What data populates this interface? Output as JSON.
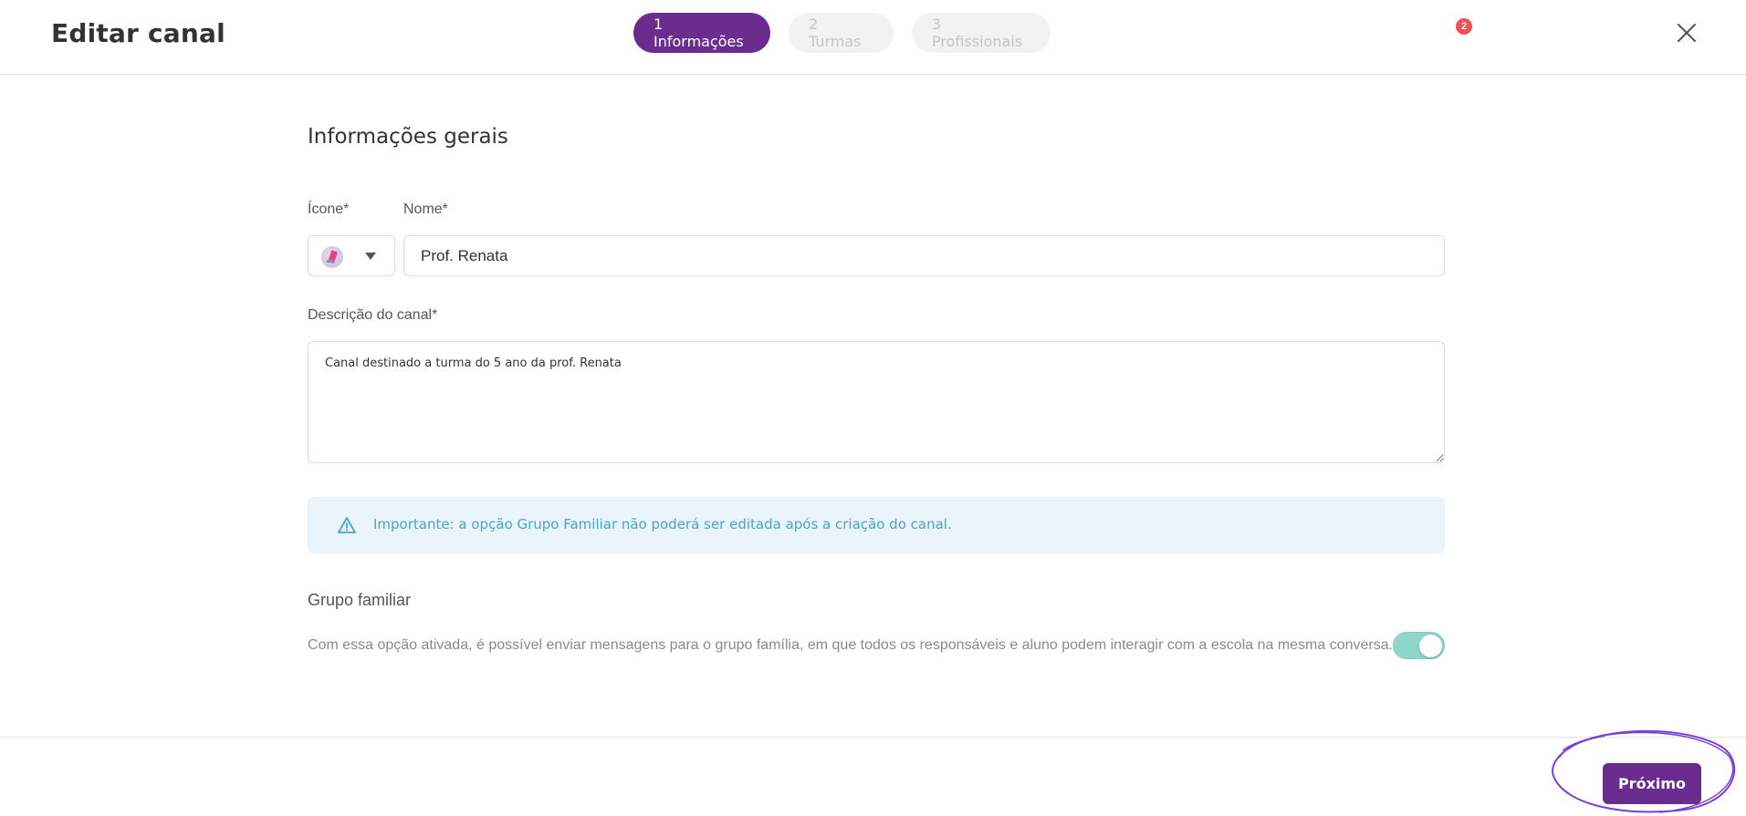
{
  "header": {
    "title": "Editar canal",
    "steps": [
      {
        "label": "1 Informações",
        "active": true
      },
      {
        "label": "2 Turmas",
        "active": false
      },
      {
        "label": "3 Profissionais",
        "active": false
      }
    ],
    "notification_count": "2",
    "close_icon": "close-icon"
  },
  "form": {
    "section_title": "Informações gerais",
    "icon_label": "Ícone*",
    "name_label": "Nome*",
    "name_value": "Prof. Renata",
    "description_label": "Descrição do canal*",
    "description_value": "Canal destinado a turma do 5 ano da prof. Renata",
    "alert_text": "Importante: a opção Grupo Familiar não poderá ser editada após a criação do canal.",
    "alert_icon": "warning-triangle-icon",
    "group_title": "Grupo familiar",
    "group_description": "Com essa opção ativada, é possível enviar mensagens para o grupo família, em que todos os responsáveis e aluno podem interagir com a escola na mesma conversa.",
    "group_toggle_on": true
  },
  "footer": {
    "next_label": "Próximo"
  },
  "colors": {
    "primary": "#6a2c8f",
    "badge": "#ef5350",
    "alert_bg": "#eaf5fb",
    "alert_text": "#4aa3c9",
    "toggle_on": "#8fd5cc"
  }
}
